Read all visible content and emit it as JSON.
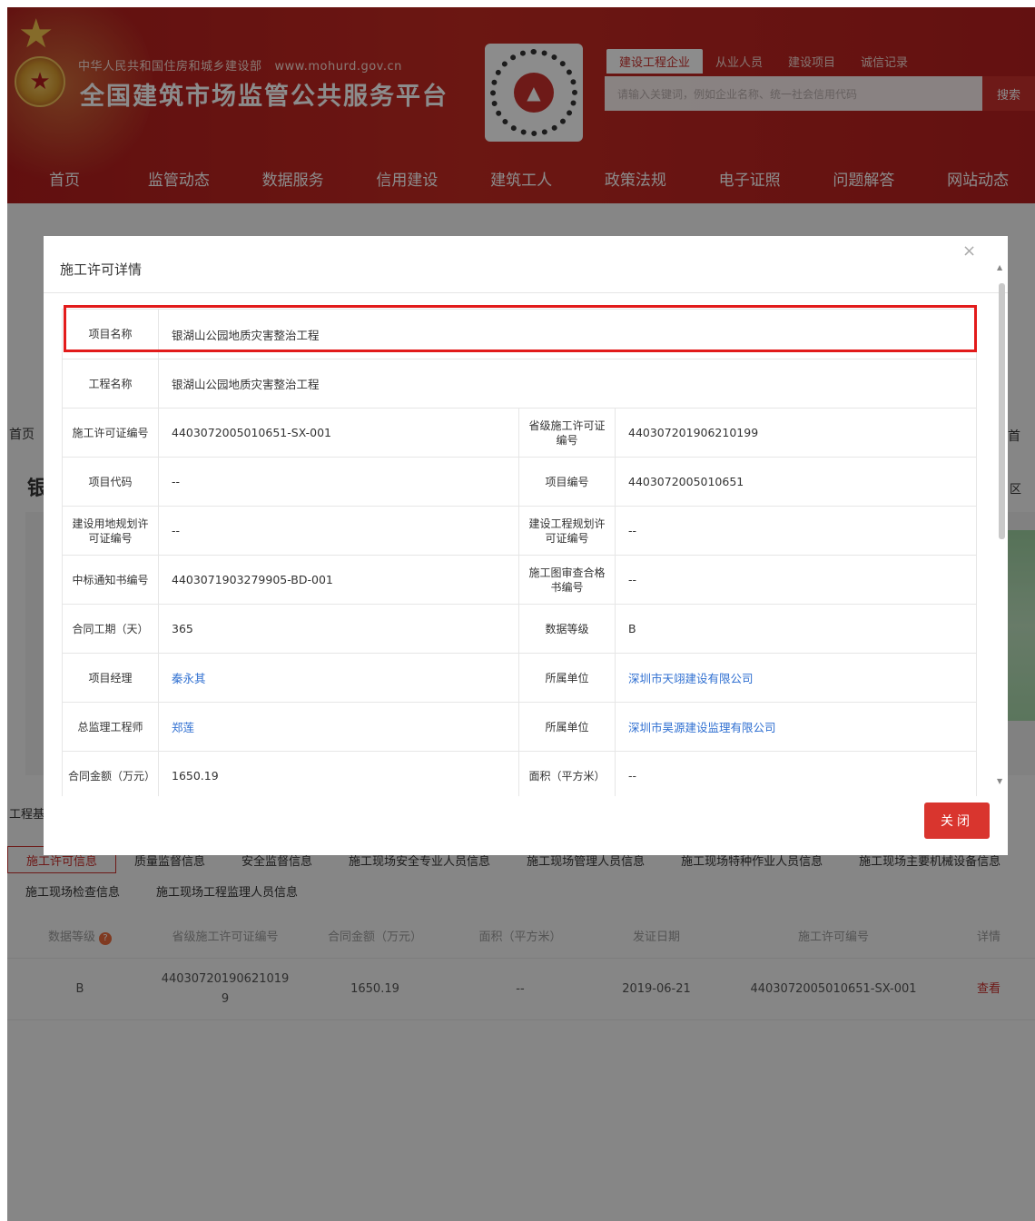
{
  "header": {
    "ministry": "中华人民共和国住房和城乡建设部",
    "url": "www.mohurd.gov.cn",
    "site_title": "全国建筑市场监管公共服务平台",
    "search_tabs": [
      "建设工程企业",
      "从业人员",
      "建设项目",
      "诚信记录"
    ],
    "search_placeholder": "请输入关键词，例如企业名称、统一社会信用代码",
    "search_button": "搜索",
    "nav": [
      "首页",
      "监管动态",
      "数据服务",
      "信用建设",
      "建筑工人",
      "政策法规",
      "电子证照",
      "问题解答",
      "网站动态"
    ]
  },
  "background": {
    "breadcrumb": "首页",
    "project_title_partial": "银",
    "right_partial_1": "首",
    "right_partial_2": "区",
    "section_label": "工程基",
    "subtabs_row1": [
      "施工许可信息",
      "质量监督信息",
      "安全监督信息",
      "施工现场安全专业人员信息",
      "施工现场管理人员信息",
      "施工现场特种作业人员信息",
      "施工现场主要机械设备信息"
    ],
    "subtabs_row2": [
      "施工现场检查信息",
      "施工现场工程监理人员信息"
    ],
    "table_headers": [
      "数据等级",
      "省级施工许可证编号",
      "合同金额（万元）",
      "面积（平方米）",
      "发证日期",
      "施工许可编号",
      "详情"
    ],
    "table_row": {
      "level": "B",
      "prov_no_line1": "44030720190621019",
      "prov_no_line2": "9",
      "amount": "1650.19",
      "area": "--",
      "date": "2019-06-21",
      "permit_no": "4403072005010651-SX-001",
      "detail": "查看"
    },
    "help_icon": "?"
  },
  "modal": {
    "title": "施工许可详情",
    "close_icon": "×",
    "close_button": "关闭",
    "rows": [
      {
        "label": "项目名称",
        "value": "银湖山公园地质灾害整治工程"
      },
      {
        "label": "工程名称",
        "value": "银湖山公园地质灾害整治工程"
      },
      {
        "label": "施工许可证编号",
        "value": "4403072005010651-SX-001",
        "label2": "省级施工许可证编号",
        "value2": "440307201906210199"
      },
      {
        "label": "项目代码",
        "value": "--",
        "label2": "项目编号",
        "value2": "4403072005010651"
      },
      {
        "label": "建设用地规划许可证编号",
        "value": "--",
        "label2": "建设工程规划许可证编号",
        "value2": "--"
      },
      {
        "label": "中标通知书编号",
        "value": "4403071903279905-BD-001",
        "label2": "施工图审查合格书编号",
        "value2": "--"
      },
      {
        "label": "合同工期（天）",
        "value": "365",
        "label2": "数据等级",
        "value2": "B"
      },
      {
        "label": "项目经理",
        "value": "秦永其",
        "label2": "所属单位",
        "value2": "深圳市天翊建设有限公司"
      },
      {
        "label": "总监理工程师",
        "value": "郑莲",
        "label2": "所属单位",
        "value2": "深圳市昊源建设监理有限公司"
      },
      {
        "label": "合同金额（万元）",
        "value": "1650.19",
        "label2": "面积（平方米）",
        "value2": "--"
      }
    ]
  },
  "colors": {
    "brand_red": "#c9302c",
    "link_blue": "#2f6fd1",
    "highlight_red": "#e21b1b"
  }
}
